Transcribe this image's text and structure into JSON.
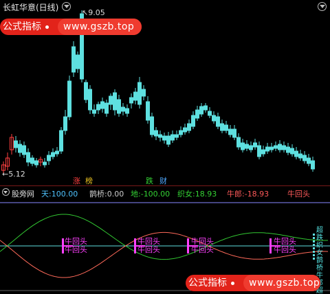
{
  "header": {
    "title": "长虹华意(日线)",
    "high_label": "9.05",
    "low_label": "5.12"
  },
  "watermark": {
    "label": "公式指标",
    "url": "www.gszb.top"
  },
  "event_markers": [
    "涨",
    "榜",
    "跌",
    "财"
  ],
  "indicator": {
    "name": "股旁网",
    "values": [
      {
        "label": "天:",
        "value": "100.00",
        "color": "#4fc3ff"
      },
      {
        "label": "鹊桥:",
        "value": "0.00",
        "color": "#cccccc"
      },
      {
        "label": "地:",
        "value": "-100.00",
        "color": "#34d234"
      },
      {
        "label": "织女:",
        "value": "18.93",
        "color": "#34d234"
      },
      {
        "label": "牛郎:",
        "value": "-18.93",
        "color": "#ff5a5a"
      },
      {
        "label": "牛回头",
        "value": "",
        "color": "#ff5a5a"
      }
    ],
    "signal_text": "牛回头",
    "side_labels": [
      "超",
      "跌",
      "织",
      "女",
      "鹊",
      "桥",
      "牛",
      "郎",
      "超",
      "跌"
    ]
  },
  "colors": {
    "up": "#ff4040",
    "down": "#5ee0e0",
    "zhinu_line": "#32c832",
    "niulang_line": "#ff6a5a",
    "magenta": "#ff40ff"
  }
}
